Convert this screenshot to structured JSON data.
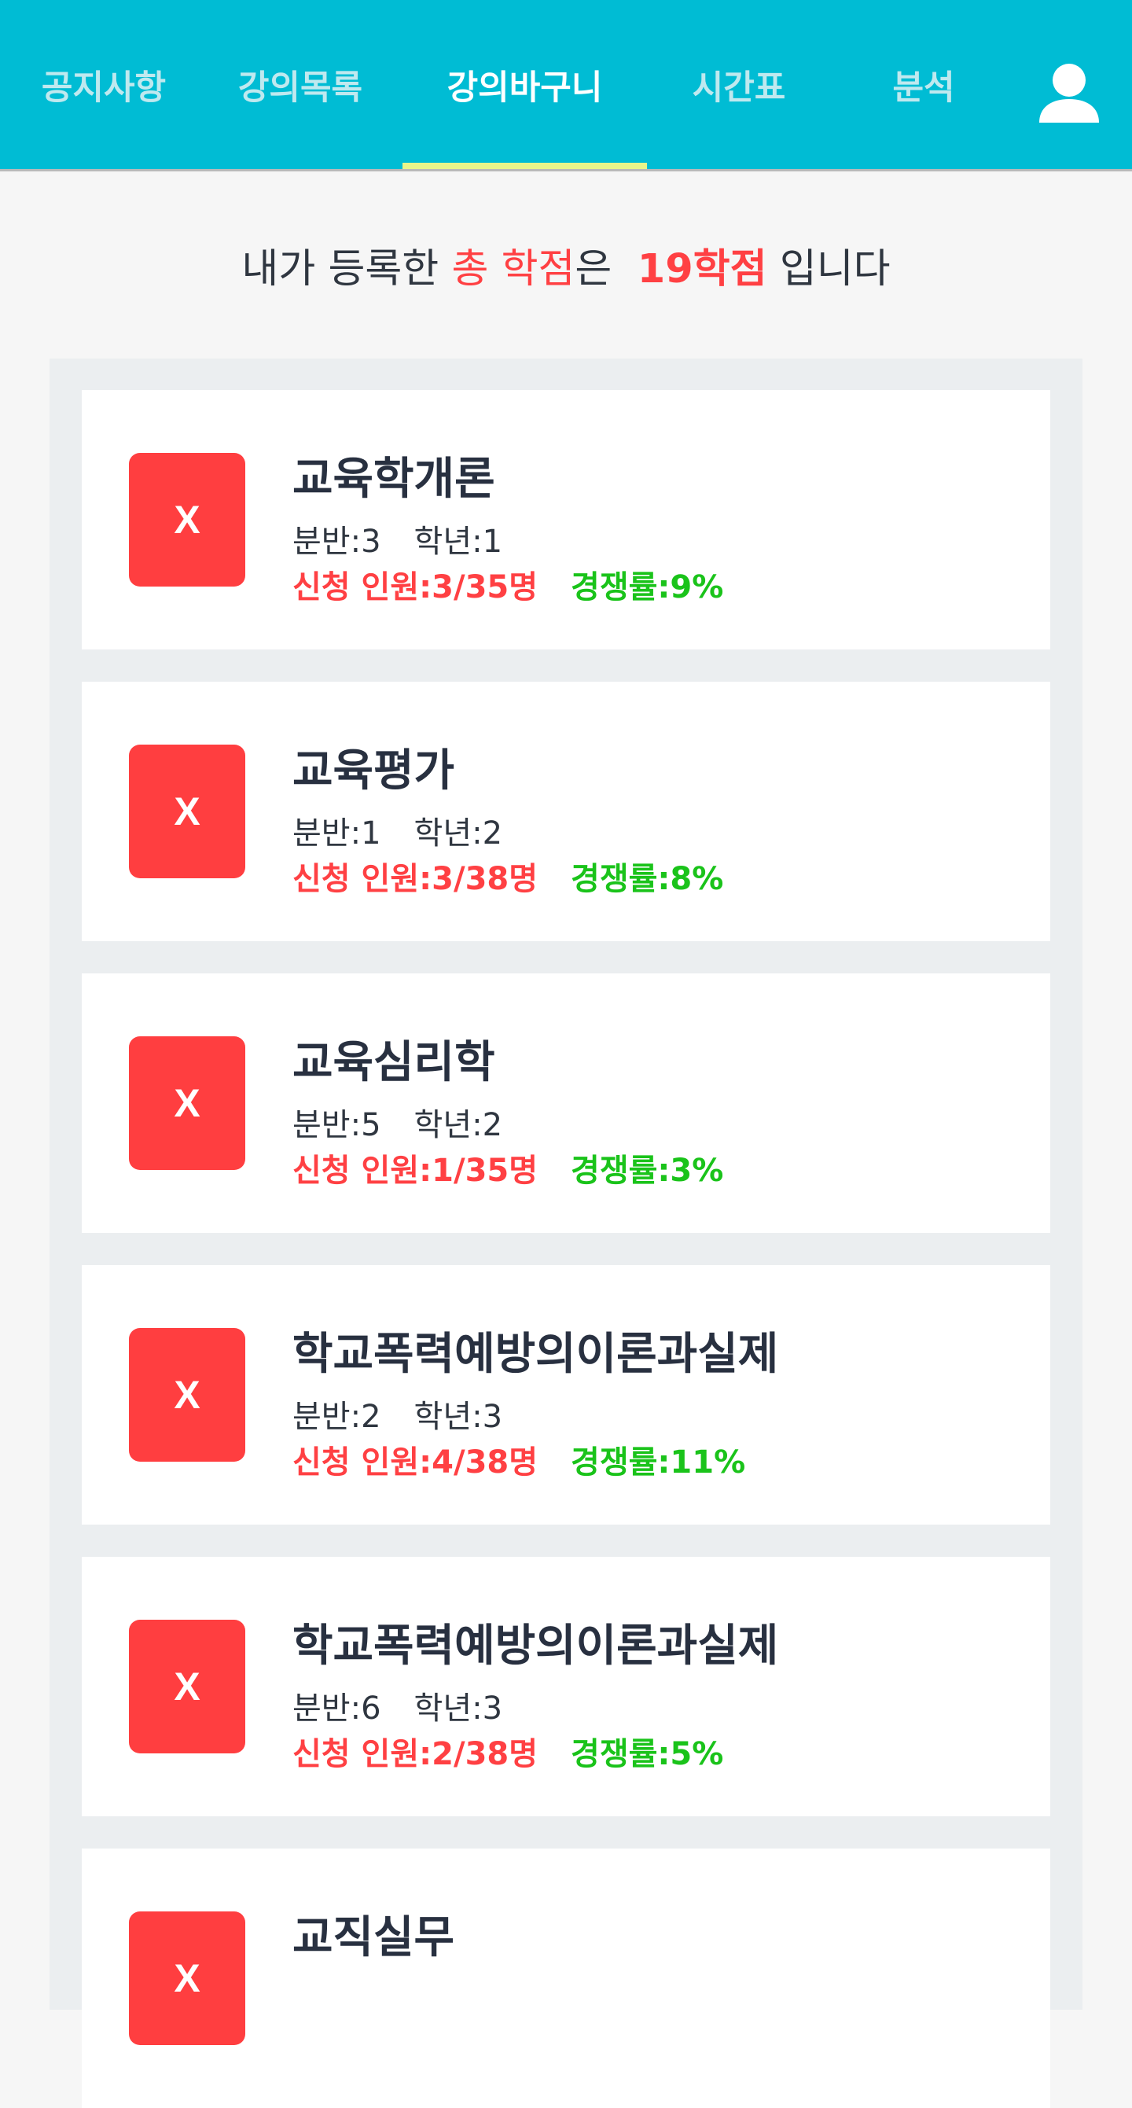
{
  "nav": {
    "tabs": [
      {
        "label": "공지사항",
        "active": false
      },
      {
        "label": "강의목록",
        "active": false
      },
      {
        "label": "강의바구니",
        "active": true
      },
      {
        "label": "시간표",
        "active": false
      },
      {
        "label": "분석",
        "active": false
      }
    ],
    "profile_icon": "user-icon"
  },
  "summary": {
    "prefix": "내가 등록한",
    "highlight": "총 학점",
    "particle": "은",
    "credits": "19학점",
    "suffix": "입니다"
  },
  "colors": {
    "header": "#00bcd4",
    "indicator": "#e8f58a",
    "danger": "#ff4043",
    "success": "#1ac31a"
  },
  "courses": [
    {
      "delete_label": "X",
      "title": "교육학개론",
      "section": "분반:3",
      "grade": "학년:1",
      "enrollment": "신청 인원:3/35명",
      "competition": "경쟁률:9%"
    },
    {
      "delete_label": "X",
      "title": "교육평가",
      "section": "분반:1",
      "grade": "학년:2",
      "enrollment": "신청 인원:3/38명",
      "competition": "경쟁률:8%"
    },
    {
      "delete_label": "X",
      "title": "교육심리학",
      "section": "분반:5",
      "grade": "학년:2",
      "enrollment": "신청 인원:1/35명",
      "competition": "경쟁률:3%"
    },
    {
      "delete_label": "X",
      "title": "학교폭력예방의이론과실제",
      "section": "분반:2",
      "grade": "학년:3",
      "enrollment": "신청 인원:4/38명",
      "competition": "경쟁률:11%"
    },
    {
      "delete_label": "X",
      "title": "학교폭력예방의이론과실제",
      "section": "분반:6",
      "grade": "학년:3",
      "enrollment": "신청 인원:2/38명",
      "competition": "경쟁률:5%"
    },
    {
      "delete_label": "X",
      "title": "교직실무",
      "section": "",
      "grade": "",
      "enrollment": "",
      "competition": ""
    }
  ]
}
